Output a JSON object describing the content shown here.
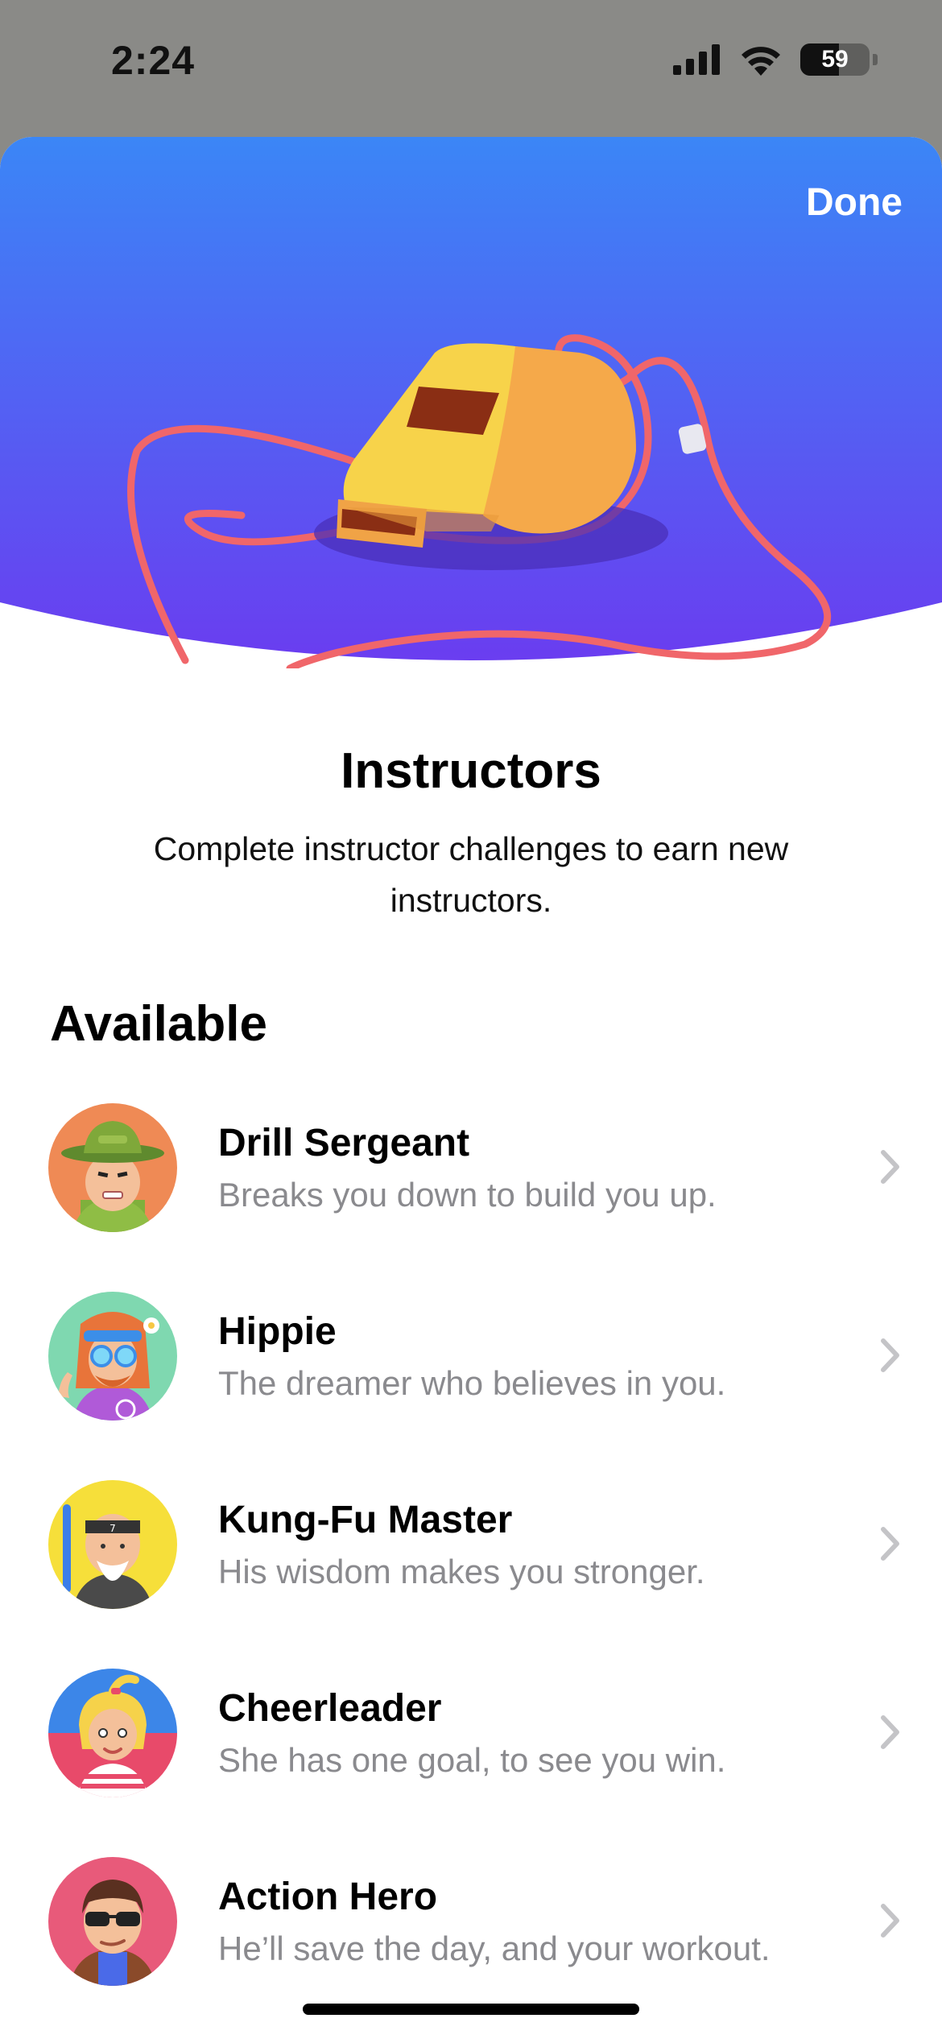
{
  "status_bar": {
    "time": "2:24",
    "battery": "59"
  },
  "header": {
    "done_label": "Done"
  },
  "title": "Instructors",
  "subtitle": "Complete instructor challenges to earn new instructors.",
  "section_available": "Available",
  "instructors": [
    {
      "name": "Drill Sergeant",
      "description": "Breaks you down to build you up.",
      "icon": "drill-sergeant-avatar"
    },
    {
      "name": "Hippie",
      "description": "The dreamer who believes in you.",
      "icon": "hippie-avatar"
    },
    {
      "name": "Kung-Fu Master",
      "description": "His wisdom makes you stronger.",
      "icon": "kung-fu-master-avatar"
    },
    {
      "name": "Cheerleader",
      "description": "She has one goal, to see you win.",
      "icon": "cheerleader-avatar"
    },
    {
      "name": "Action Hero",
      "description": "He’ll save the day, and your workout.",
      "icon": "action-hero-avatar"
    }
  ],
  "colors": {
    "hero_top": "#3b86f6",
    "hero_bottom": "#6a3df0",
    "cord": "#f0666a",
    "whistle": "#f7d34a"
  }
}
